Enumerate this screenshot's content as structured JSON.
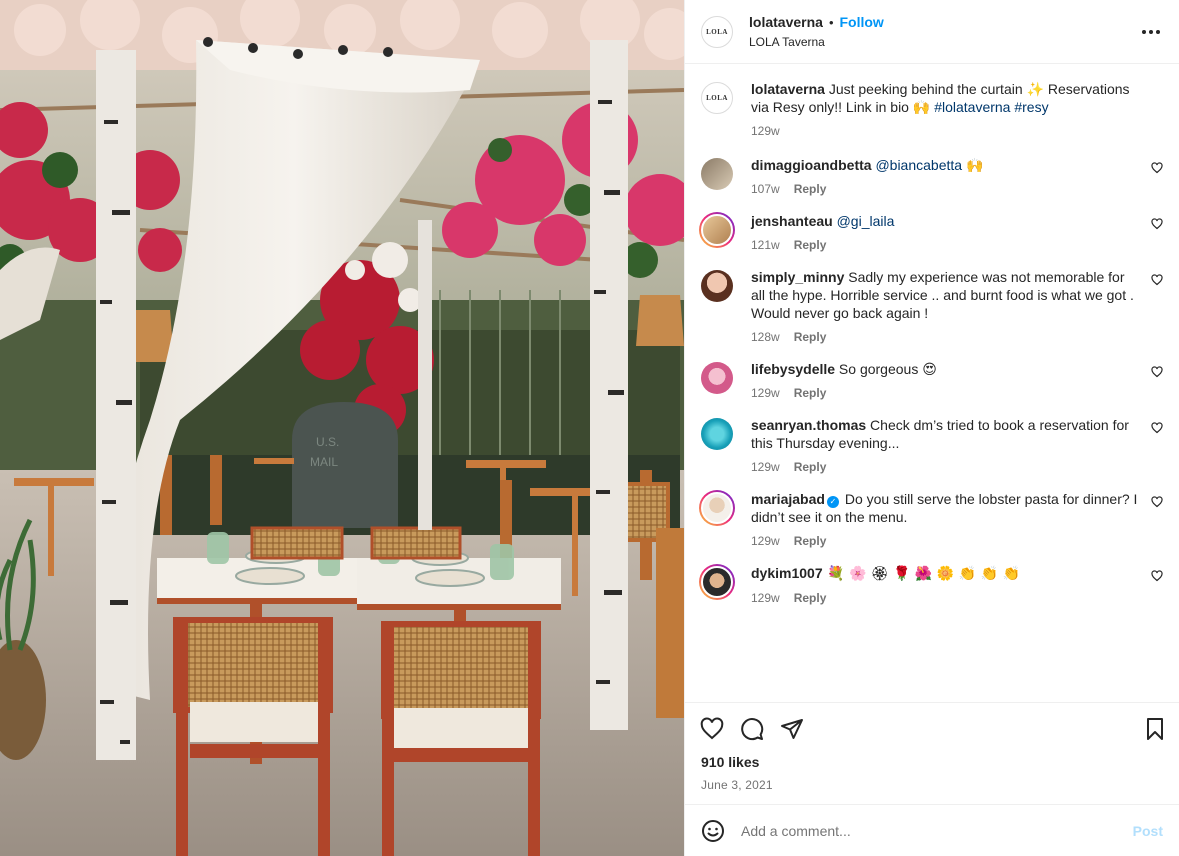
{
  "header": {
    "avatar_text": "LOLA",
    "username": "lolataverna",
    "separator": "•",
    "follow_label": "Follow",
    "subtitle": "LOLA Taverna"
  },
  "caption": {
    "username": "lolataverna",
    "text_before": " Just peeking behind the curtain ✨ Reservations via Resy only!! Link in bio 🙌 ",
    "hashtags": "#lolataverna #resy",
    "time": "129w"
  },
  "comments": [
    {
      "username": "dimaggioandbetta",
      "text": " ",
      "mention": "@biancabetta",
      "after": " 🙌",
      "time": "107w",
      "reply": "Reply"
    },
    {
      "username": "jenshanteau",
      "text": " ",
      "mention": "@gi_laila",
      "after": "",
      "time": "121w",
      "reply": "Reply"
    },
    {
      "username": "simply_minny",
      "text": " Sadly my experience was not memorable for all the hype. Horrible service .. and burnt food is what we got . Would never go back again !",
      "mention": "",
      "after": "",
      "time": "128w",
      "reply": "Reply"
    },
    {
      "username": "lifebysydelle",
      "text": " So gorgeous 😍",
      "mention": "",
      "after": "",
      "time": "129w",
      "reply": "Reply"
    },
    {
      "username": "seanryan.thomas",
      "text": " Check dm’s tried to book a reservation for this Thursday evening...",
      "mention": "",
      "after": "",
      "time": "129w",
      "reply": "Reply"
    },
    {
      "username": "mariajabad",
      "text": " Do you still serve the lobster pasta for dinner? I didn’t see it on the menu.",
      "mention": "",
      "after": "",
      "time": "129w",
      "reply": "Reply"
    },
    {
      "username": "dykim1007",
      "text": " 💐 🌸 🏵 🌹 🌺 🌼 👏 👏 👏",
      "mention": "",
      "after": "",
      "time": "129w",
      "reply": "Reply"
    }
  ],
  "likes": "910 likes",
  "date": "June 3, 2021",
  "add_comment": {
    "placeholder": "Add a comment...",
    "post_label": "Post"
  },
  "colors": {
    "link_blue": "#0095f6",
    "mention_blue": "#00376b",
    "muted": "#737373",
    "post_disabled": "#b2dffc"
  },
  "icons": {
    "more": "more-options-icon",
    "like": "heart-icon",
    "comment": "comment-bubble-icon",
    "share": "paper-plane-icon",
    "save": "bookmark-icon",
    "emoji": "smiley-icon"
  }
}
